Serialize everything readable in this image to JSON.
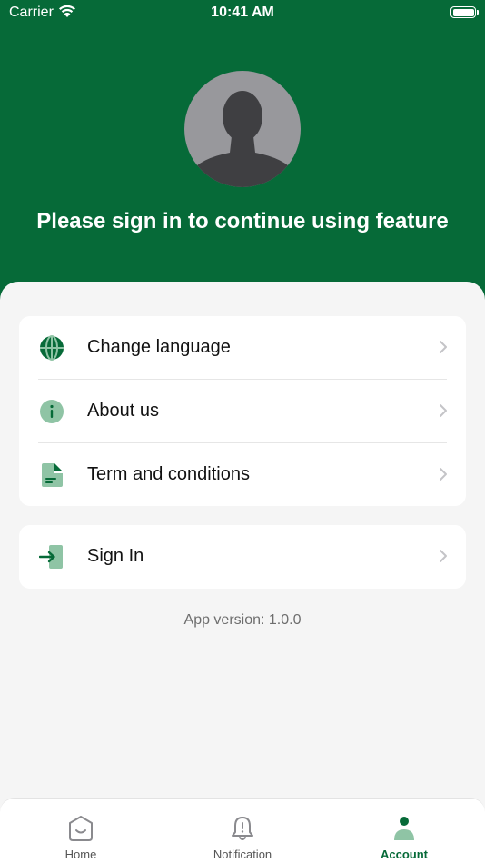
{
  "status_bar": {
    "carrier": "Carrier",
    "time": "10:41 AM"
  },
  "header": {
    "title": "Please sign in to continue using feature"
  },
  "menu": {
    "items": [
      {
        "label": "Change language",
        "icon": "globe-icon"
      },
      {
        "label": "About us",
        "icon": "info-icon"
      },
      {
        "label": "Term and conditions",
        "icon": "document-icon"
      }
    ]
  },
  "signin": {
    "label": "Sign In",
    "icon": "sign-in-icon"
  },
  "app_version": "App version: 1.0.0",
  "tabbar": {
    "tabs": [
      {
        "label": "Home",
        "icon": "home-icon",
        "active": false
      },
      {
        "label": "Notification",
        "icon": "bell-icon",
        "active": false
      },
      {
        "label": "Account",
        "icon": "account-icon",
        "active": true
      }
    ]
  },
  "colors": {
    "brand": "#066a38",
    "icon_light": "#8fc4a5",
    "background": "#f5f5f5"
  }
}
